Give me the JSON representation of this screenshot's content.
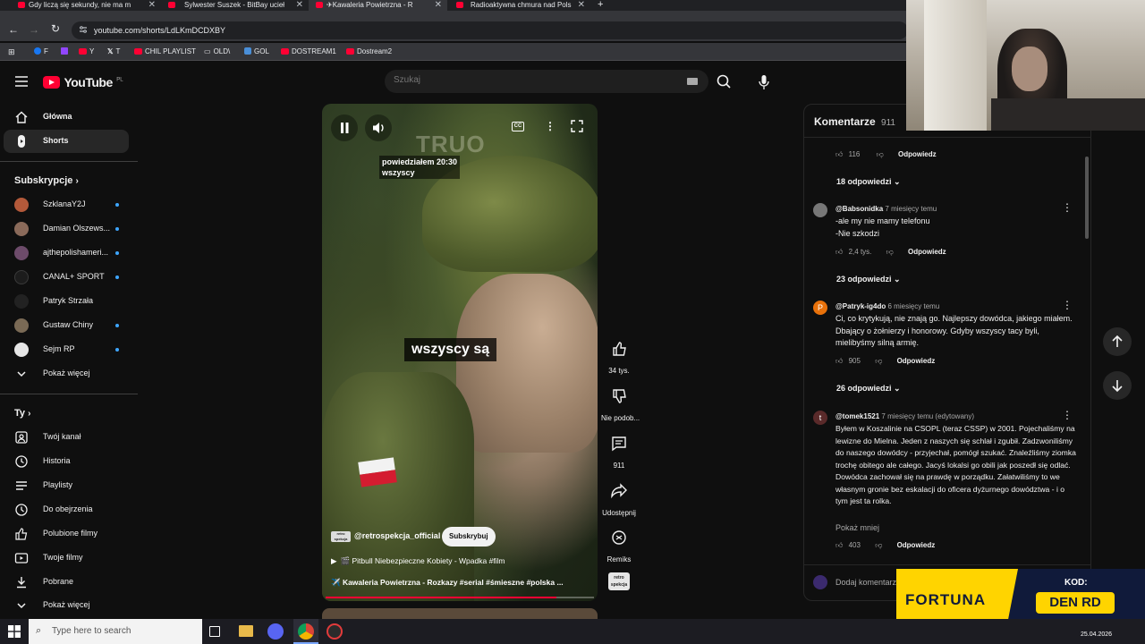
{
  "browser": {
    "tabs": [
      {
        "title": "Gdy liczą się sekundy, nie ma m"
      },
      {
        "title": "Sylwester Suszek - BitBay ucieł"
      },
      {
        "title": "✈Kawaleria Powietrzna - R"
      },
      {
        "title": "Radioaktywna chmura nad Pols"
      }
    ],
    "new_tab_symbol": "+",
    "url": "youtube.com/shorts/LdLKmDCDXBY",
    "bookmarks": [
      "F",
      "Y",
      "T",
      "CHIL PLAYLIST",
      "OLD\\",
      "GOL",
      "DOSTREAM1",
      "Dostream2"
    ]
  },
  "youtube": {
    "logo_text": "YouTube",
    "region": "PL",
    "search_placeholder": "Szukaj"
  },
  "sidebar": {
    "main": [
      {
        "label": "Główna",
        "icon": "home-icon"
      },
      {
        "label": "Shorts",
        "icon": "shorts-icon"
      }
    ],
    "subscriptions_title": "Subskrypcje",
    "subscriptions": [
      {
        "label": "SzklanaY2J",
        "color": "#b3593a"
      },
      {
        "label": "Damian Olszews...",
        "color": "#8a6a5a"
      },
      {
        "label": "ajthepolishameri...",
        "color": "#6d4b6a"
      },
      {
        "label": "CANAL+ SPORT",
        "color": "#1c1c1c"
      },
      {
        "label": "Patryk Strzała",
        "color": "#222222"
      },
      {
        "label": "Gustaw Chiny",
        "color": "#7a6a55"
      },
      {
        "label": "Sejm RP",
        "color": "#e6e6e6"
      }
    ],
    "show_more_1": "Pokaż więcej",
    "you_title": "Ty",
    "you_items": [
      {
        "label": "Twój kanał",
        "icon": "account-icon"
      },
      {
        "label": "Historia",
        "icon": "history-icon"
      },
      {
        "label": "Playlisty",
        "icon": "playlists-icon"
      },
      {
        "label": "Do obejrzenia",
        "icon": "watch-later-icon"
      },
      {
        "label": "Polubione filmy",
        "icon": "thumb-up-icon"
      },
      {
        "label": "Twoje filmy",
        "icon": "your-videos-icon"
      },
      {
        "label": "Pobrane",
        "icon": "download-icon"
      }
    ],
    "show_more_2": "Pokaż więcej"
  },
  "video": {
    "overlay_caption": "powiedziałem 20:30\nwszyscy",
    "main_caption": "wszyscy są",
    "channel": "@retrospekcja_official",
    "subscribe": "Subskrybuj",
    "playlist_line": "🎬 Pitbull Niebezpieczne Kobiety - Wpadka #film",
    "title": "✈️ Kawaleria Powietrzna - Rozkazy #serial #śmieszne #polska ...",
    "progress": 0.86
  },
  "actions": {
    "likes": "34 tys.",
    "dislike": "Nie podob...",
    "comments": "911",
    "share": "Udostępnij",
    "remix": "Remiks"
  },
  "comments": {
    "title": "Komentarze",
    "count": "911",
    "top_likes": "116",
    "reply": "Odpowiedz",
    "items": [
      {
        "replies": "18 odpowiedzi"
      },
      {
        "author": "@Babsonidka",
        "time": "7 miesięcy temu",
        "text": "-ale my nie mamy telefonu\n-Nie szkodzi",
        "likes": "2,4 tys.",
        "replies": "23 odpowiedzi"
      },
      {
        "author": "@Patryk-ig4do",
        "time": "6 miesięcy temu",
        "avatar_letter": "P",
        "avatar_color": "#e8710a",
        "text": "Ci, co krytykują, nie znają go. Najlepszy dowódca, jakiego miałem. Dbający o żołnierzy i honorowy. Gdyby wszyscy tacy byli, mielibyśmy silną armię.",
        "likes": "905",
        "replies": "26 odpowiedzi"
      },
      {
        "author": "@tomek1521",
        "time": "7 miesięcy temu (edytowany)",
        "avatar_letter": "t",
        "avatar_color": "#5a2a2a",
        "text": "Byłem w Koszalinie na CSOPL (teraz CSSP) w 2001. Pojechaliśmy na lewizne do Mielna. Jeden z naszych się schlał i zgubił. Zadzwoniliśmy do naszego dowódcy - przyjechał, pomógł szukać. Znaleźliśmy ziomka trochę obitego ale całego. Jacyś lokalsi go obili jak poszedł się odlać. Dowódca zachował się na prawdę w porządku. Załatwiliśmy to we własnym gronie bez eskalacji do oficera dyżurnego dowództwa - i o tym jest ta rolka.",
        "show_less": "Pokaż mniej",
        "likes": "403"
      }
    ],
    "add_placeholder": "Dodaj komentarz..."
  },
  "ad": {
    "brand": "FORTUNA",
    "code_label": "KOD:",
    "code": "DEN RD"
  },
  "taskbar": {
    "search_placeholder": "Type here to search",
    "date": "25.04.2026"
  }
}
